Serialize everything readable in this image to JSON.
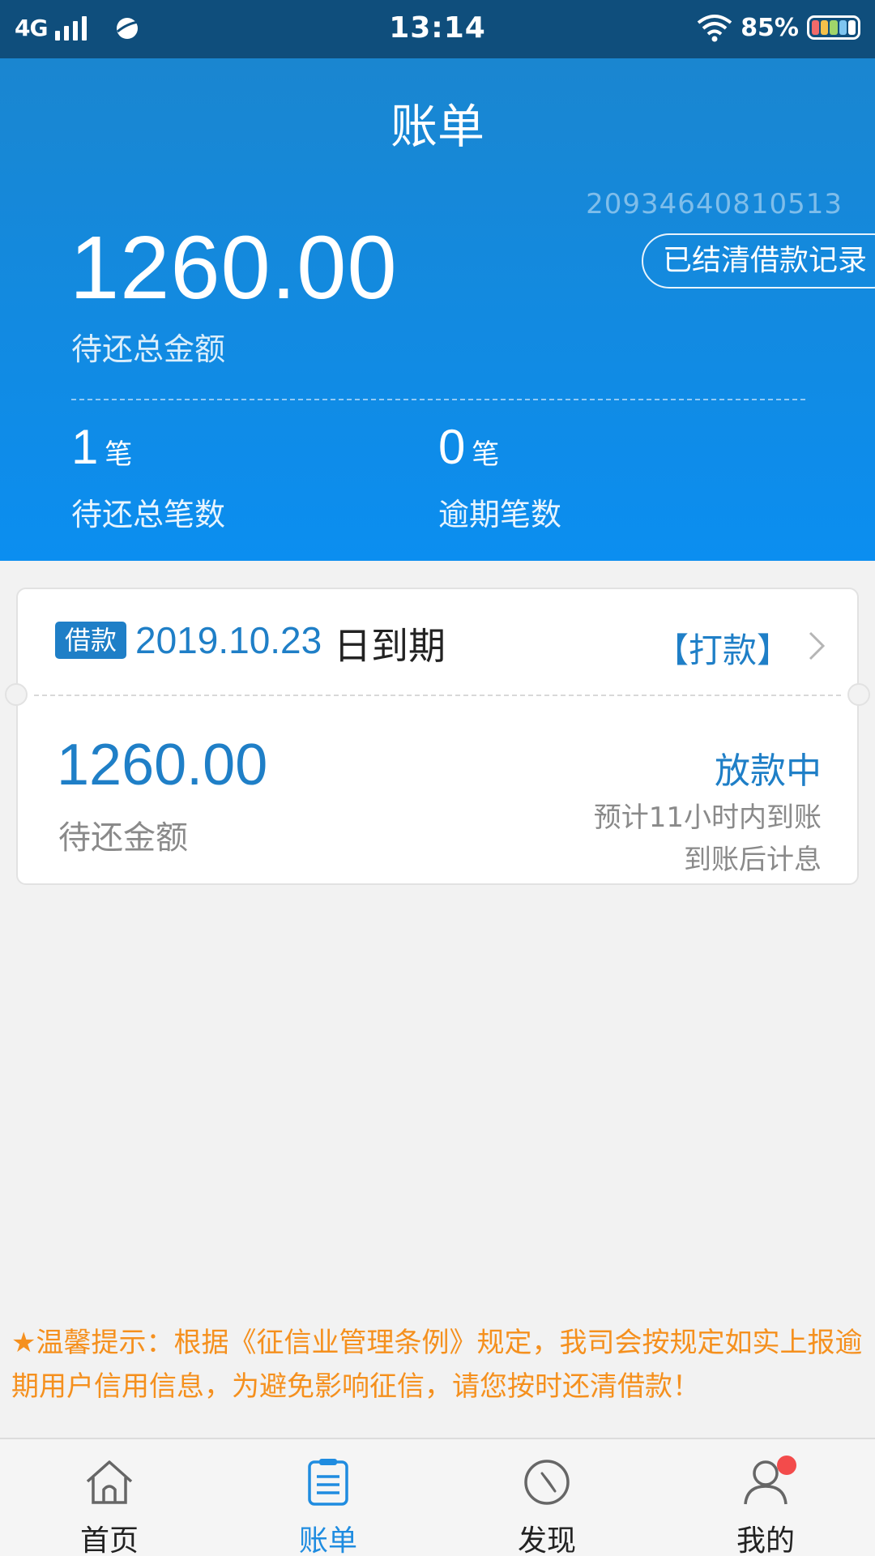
{
  "status_bar": {
    "network": "4G",
    "time": "13:14",
    "battery": "85%",
    "signal_icon": "signal-bars-icon",
    "app_icon": "planet-icon",
    "wifi_icon": "wifi-icon",
    "battery_icon": "battery-icon"
  },
  "header": {
    "title": "账单",
    "account_number": "20934640810513",
    "history_button": "已结清借款记录",
    "total_amount": "1260.00",
    "total_label": "待还总金额",
    "stats": [
      {
        "value": "1",
        "unit": "笔",
        "label": "待还总笔数"
      },
      {
        "value": "0",
        "unit": "笔",
        "label": "逾期笔数"
      }
    ]
  },
  "loan_card": {
    "tag": "借款",
    "due_date": "2019.10.23",
    "due_suffix": "日到期",
    "action": "【打款】",
    "amount": "1260.00",
    "amount_label": "待还金额",
    "status": "放款中",
    "eta": "预计11小时内到账",
    "interest_note": "到账后计息"
  },
  "tip": "★温馨提示：根据《征信业管理条例》规定，我司会按规定如实上报逾期用户信用信息，为避免影响征信，请您按时还清借款！",
  "tabs": [
    {
      "label": "首页",
      "icon": "home-icon",
      "active": false
    },
    {
      "label": "账单",
      "icon": "bill-icon",
      "active": true
    },
    {
      "label": "发现",
      "icon": "compass-icon",
      "active": false
    },
    {
      "label": "我的",
      "icon": "user-icon",
      "active": false
    }
  ],
  "colors": {
    "header_top": "#1a86d0",
    "header_bottom": "#0b8ef0",
    "accent_blue": "#1f7fc7",
    "tip_orange": "#f5901e",
    "badge_red": "#f34b4b"
  }
}
